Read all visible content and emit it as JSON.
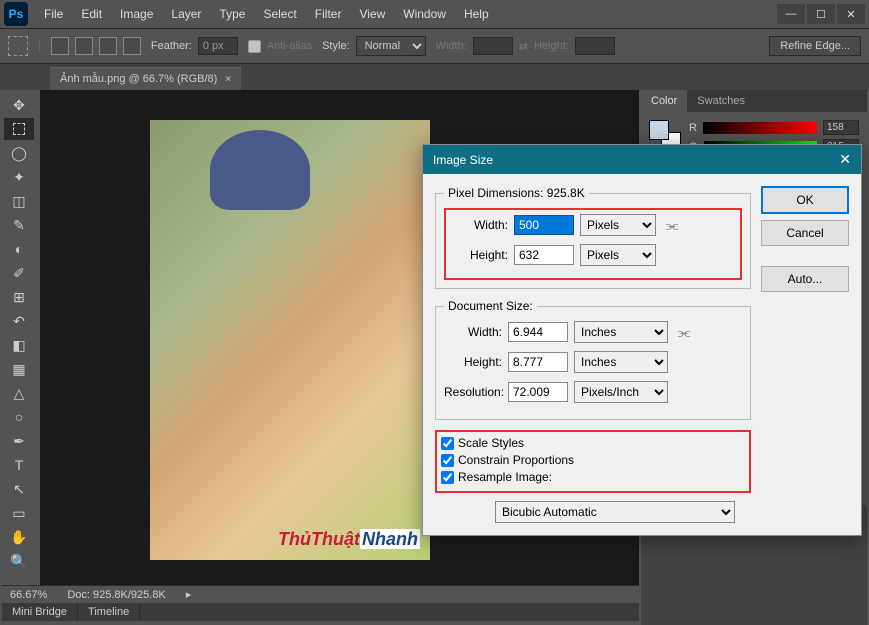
{
  "app": {
    "name": "Ps"
  },
  "menu": [
    "File",
    "Edit",
    "Image",
    "Layer",
    "Type",
    "Select",
    "Filter",
    "View",
    "Window",
    "Help"
  ],
  "window_controls": {
    "min": "—",
    "max": "☐",
    "close": "✕"
  },
  "options_bar": {
    "feather_label": "Feather:",
    "feather_value": "0 px",
    "antialias": "Anti-alias",
    "style_label": "Style:",
    "style_value": "Normal",
    "width_label": "Width:",
    "height_label": "Height:",
    "refine": "Refine Edge..."
  },
  "doc_tab": {
    "title": "Ảnh mẫu.png @ 66.7% (RGB/8)",
    "close": "×"
  },
  "zoom": {
    "value": "66.67%",
    "doc_info": "Doc: 925.8K/925.8K"
  },
  "bottom_tabs": [
    "Mini Bridge",
    "Timeline"
  ],
  "panel": {
    "tabs": [
      "Color",
      "Swatches"
    ],
    "r_label": "R",
    "r_value": "158",
    "g_label": "G",
    "g_value": "215"
  },
  "dialog": {
    "title": "Image Size",
    "pixel_legend": "Pixel Dimensions:  925.8K",
    "width_label": "Width:",
    "width_value": "500",
    "height_label": "Height:",
    "height_value": "632",
    "pixels_unit": "Pixels",
    "doc_legend": "Document Size:",
    "doc_width_label": "Width:",
    "doc_width_value": "6.944",
    "doc_height_label": "Height:",
    "doc_height_value": "8.777",
    "inches_unit": "Inches",
    "res_label": "Resolution:",
    "res_value": "72.009",
    "res_unit": "Pixels/Inch",
    "scale_styles": "Scale Styles",
    "constrain": "Constrain Proportions",
    "resample": "Resample Image:",
    "resample_method": "Bicubic Automatic",
    "ok": "OK",
    "cancel": "Cancel",
    "auto": "Auto...",
    "close": "✕"
  },
  "watermark": {
    "t1": "ThủThuật",
    "t2": "Nhanh"
  }
}
